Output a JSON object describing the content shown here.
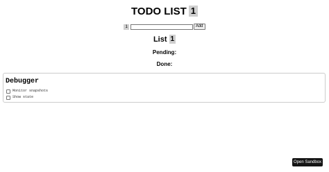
{
  "header": {
    "title": "TODO LIST",
    "count": "1"
  },
  "add_form": {
    "count": "1",
    "input_value": "",
    "input_placeholder": "",
    "add_label": "Add"
  },
  "list": {
    "title": "List",
    "count": "1",
    "pending_label": "Pending:",
    "done_label": "Done:"
  },
  "debugger": {
    "title": "Debugger",
    "options": [
      {
        "label": "Monitor snapshots",
        "checked": false
      },
      {
        "label": "Show state",
        "checked": false
      }
    ]
  },
  "sandbox": {
    "button_label": "Open Sandbox"
  }
}
